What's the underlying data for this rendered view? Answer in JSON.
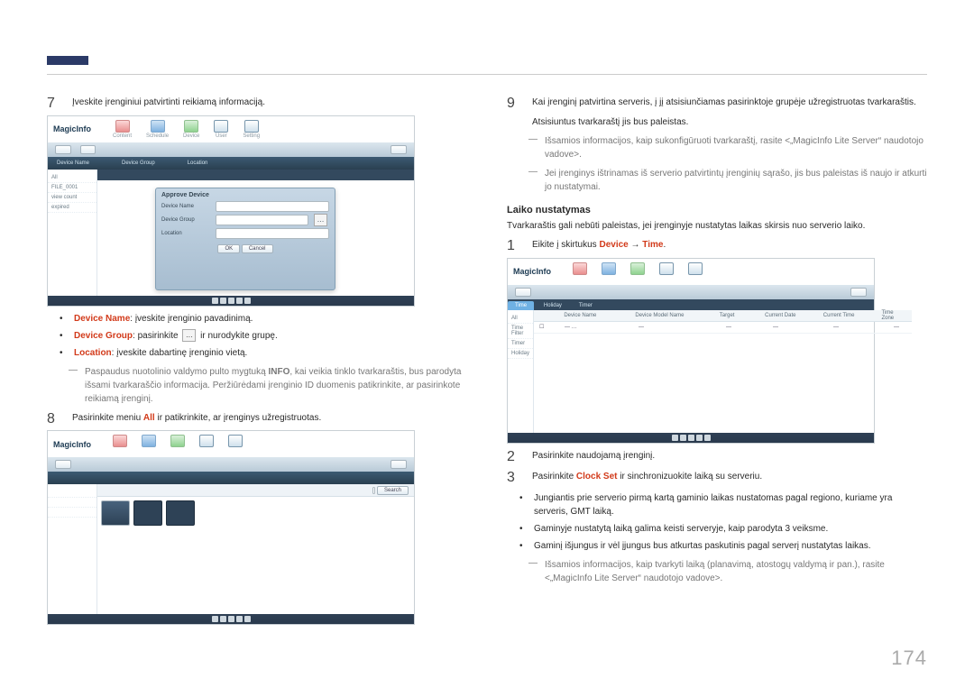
{
  "page_number": "174",
  "accent": "#2b3a67",
  "left": {
    "step7": {
      "num": "7",
      "text": "Įveskite įrenginiui patvirtinti reikiamą informaciją."
    },
    "screenshot1": {
      "logo": "MagicInfo",
      "tabs": [
        "Content",
        "Schedule",
        "Device",
        "User",
        "Setting"
      ],
      "menu_cols": [
        "Device Name",
        "Device Group",
        "Location"
      ],
      "dialog": {
        "title": "Approve Device",
        "fields": {
          "device_name": "Device Name",
          "device_group": "Device Group",
          "location": "Location"
        },
        "ok": "OK",
        "cancel": "Cancel"
      },
      "sidebar": [
        "All",
        "FILE_0001",
        "view count",
        "expired"
      ]
    },
    "bul_devname": {
      "label": "Device Name",
      "text": ": įveskite įrenginio pavadinimą."
    },
    "bul_devgroup": {
      "label": "Device Group",
      "text_a": ": pasirinkite ",
      "text_b": " ir nurodykite grupę.",
      "icon_glyph": "…"
    },
    "bul_location": {
      "label": "Location",
      "text": ": įveskite dabartinę įrenginio vietą."
    },
    "dash_info": {
      "a": "Paspaudus nuotolinio valdymo pulto mygtuką ",
      "info": "INFO",
      "b": ", kai veikia tinklo tvarkaraštis, bus parodyta išsami tvarkaraščio informacija. Peržiūrėdami įrenginio ID duomenis patikrinkite, ar pasirinkote reikiamą įrenginį."
    },
    "step8": {
      "num": "8",
      "text_a": "Pasirinkite meniu ",
      "all": "All",
      "text_b": " ir patikrinkite, ar įrenginys užregistruotas."
    },
    "screenshot2": {
      "logo": "MagicInfo",
      "header_right": "Search"
    }
  },
  "right": {
    "step9": {
      "num": "9",
      "line1": "Kai įrenginį patvirtina serveris, į jį atsisiunčiamas pasirinktoje grupėje užregistruotas tvarkaraštis.",
      "line2": "Atsisiuntus tvarkaraštį jis bus paleistas."
    },
    "dash1": "Išsamios informacijos, kaip sukonfigūruoti tvarkaraštį, rasite <„MagicInfo Lite Server“ naudotojo vadove>.",
    "dash2": "Jei įrenginys ištrinamas iš serverio patvirtintų įrenginių sąrašo, jis bus paleistas iš naujo ir atkurti jo nustatymai.",
    "section_title": "Laiko nustatymas",
    "section_intro": "Tvarkaraštis gali nebūti paleistas, jei įrenginyje nustatytas laikas skirsis nuo serverio laiko.",
    "step1": {
      "num": "1",
      "text_a": "Eikite į skirtukus ",
      "device": "Device",
      "arrow": " → ",
      "time": "Time",
      "text_b": "."
    },
    "screenshot3": {
      "logo": "MagicInfo",
      "tabs": [
        "Time",
        "Holiday",
        "Timer"
      ],
      "cols": {
        "sel": " ",
        "name": "Device Name",
        "model": "Device Model Name",
        "target": "Target",
        "date": "Current Date",
        "ti": "Current Time",
        "tz": "Time Zone"
      },
      "row": {
        "name": "— …",
        "model": "—",
        "target": "—",
        "date": "—",
        "ti": "—",
        "tz": "—"
      },
      "sidebar": [
        "All",
        "Time Filter",
        "Timer",
        "Holiday"
      ]
    },
    "step2": {
      "num": "2",
      "text": "Pasirinkite naudojamą įrenginį."
    },
    "step3": {
      "num": "3",
      "text_a": "Pasirinkite ",
      "kw": "Clock Set",
      "text_b": " ir sinchronizuokite laiką su serveriu."
    },
    "bul1": "Jungiantis prie serverio pirmą kartą gaminio laikas nustatomas pagal regiono, kuriame yra serveris, GMT laiką.",
    "bul2": "Gaminyje nustatytą laiką galima keisti serveryje, kaip parodyta 3 veiksme.",
    "bul3": "Gaminį išjungus ir vėl įjungus bus atkurtas paskutinis pagal serverį nustatytas laikas.",
    "dash3": "Išsamios informacijos, kaip tvarkyti laiką (planavimą, atostogų valdymą ir pan.), rasite <„MagicInfo Lite Server“ naudotojo vadove>."
  }
}
